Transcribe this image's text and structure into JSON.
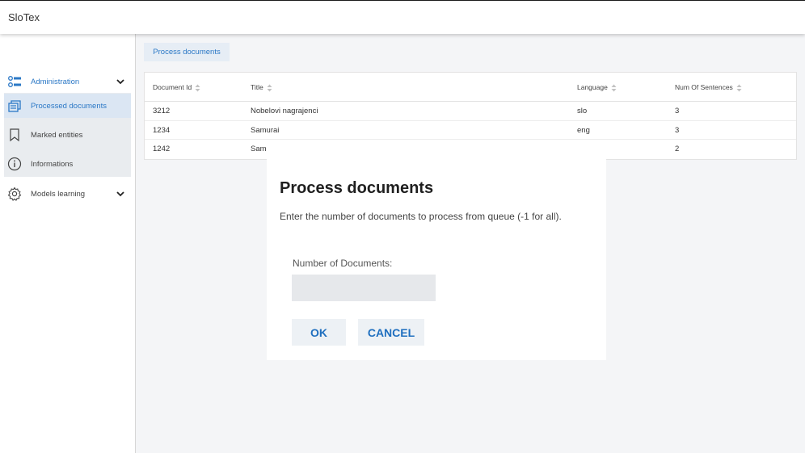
{
  "app": {
    "title": "SloTex"
  },
  "sidebar": {
    "items": [
      {
        "label": "Administration",
        "icon": "list-settings-icon"
      },
      {
        "label": "Processed documents",
        "icon": "documents-icon"
      },
      {
        "label": "Marked entities",
        "icon": "bookmark-icon"
      },
      {
        "label": "Informations",
        "icon": "info-icon"
      },
      {
        "label": "Models learning",
        "icon": "gear-icon"
      }
    ]
  },
  "toolbar": {
    "process_label": "Process documents"
  },
  "table": {
    "columns": [
      "Document Id",
      "Title",
      "Language",
      "Num Of Sentences"
    ],
    "rows": [
      [
        "3212",
        "Nobelovi nagrajenci",
        "slo",
        "3"
      ],
      [
        "1234",
        "Samurai",
        "eng",
        "3"
      ],
      [
        "1242",
        "Sam",
        "",
        "2"
      ]
    ]
  },
  "dialog": {
    "title": "Process documents",
    "description": "Enter the number of documents to process from queue (-1 for all).",
    "field_label": "Number of Documents:",
    "field_value": "",
    "ok_label": "OK",
    "cancel_label": "CANCEL"
  },
  "colors": {
    "accent": "#2b78c6",
    "active_bg": "#dbe6f3",
    "submenu_bg": "#e9ecef",
    "content_bg": "#f4f5f7",
    "button_text": "#1f6fbf"
  }
}
